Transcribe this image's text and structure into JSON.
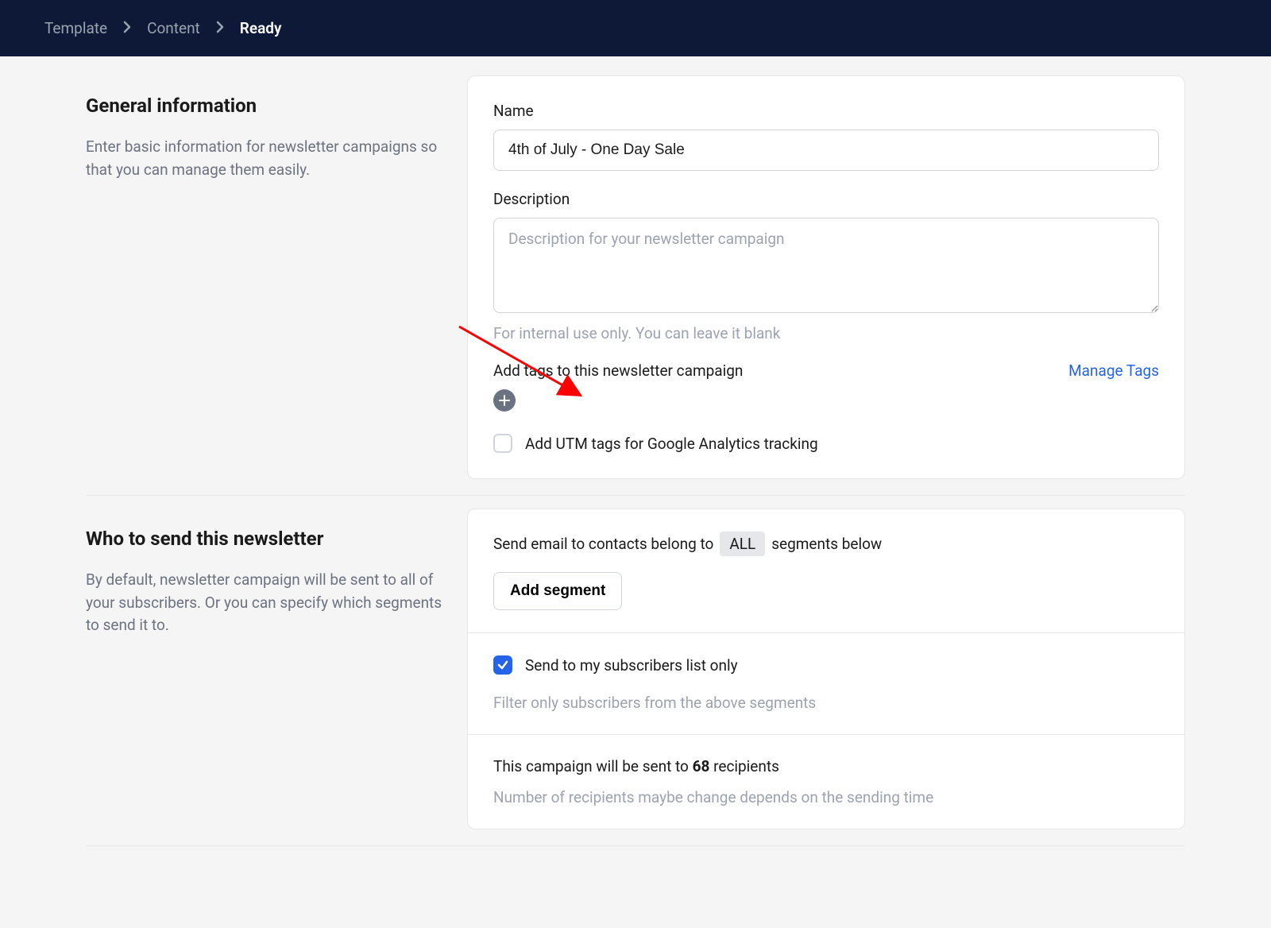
{
  "breadcrumbs": {
    "items": [
      {
        "label": "Template",
        "active": false
      },
      {
        "label": "Content",
        "active": false
      },
      {
        "label": "Ready",
        "active": true
      }
    ]
  },
  "general_info": {
    "title": "General information",
    "description": "Enter basic information for newsletter campaigns so that you can manage them easily.",
    "name_label": "Name",
    "name_value": "4th of July - One Day Sale",
    "desc_label": "Description",
    "desc_placeholder": "Description for your newsletter campaign",
    "desc_help": "For internal use only. You can leave it blank",
    "tags_label": "Add tags to this newsletter campaign",
    "manage_tags": "Manage Tags",
    "utm_label": "Add UTM tags for Google Analytics tracking"
  },
  "who_send": {
    "title": "Who to send this newsletter",
    "description": "By default, newsletter campaign will be sent to all of your subscribers. Or you can specify which segments to send it to.",
    "send_prefix": "Send email to contacts belong to",
    "send_pill": "ALL",
    "send_suffix": "segments below",
    "add_segment_btn": "Add segment",
    "subscribers_label": "Send to my subscribers list only",
    "filter_help": "Filter only subscribers from the above segments",
    "recipients_prefix": "This campaign will be sent to",
    "recipients_count": "68",
    "recipients_suffix": "recipients",
    "recipients_help": "Number of recipients maybe change depends on the sending time"
  }
}
